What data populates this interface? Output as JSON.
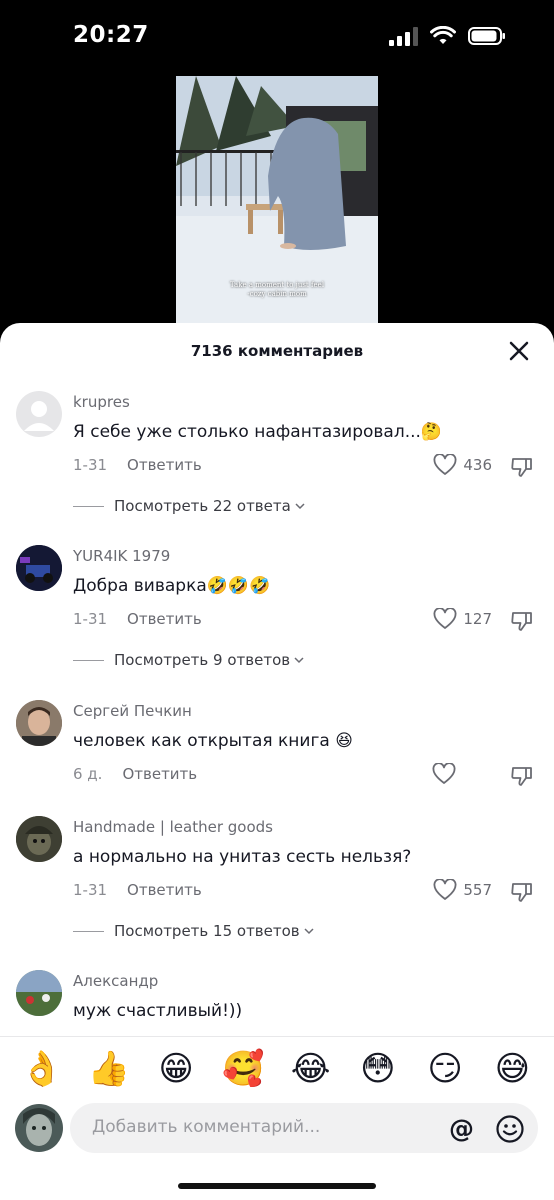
{
  "status_bar": {
    "time": "20:27"
  },
  "video": {
    "caption_line1": "Take a moment to just feel",
    "caption_line2": "-cozy cabin mom"
  },
  "sheet": {
    "title": "7136 комментариев"
  },
  "comments": [
    {
      "username": "krupres",
      "text": "Я себе уже столько нафантазировал...🤔",
      "date": "1-31",
      "reply_label": "Ответить",
      "likes": "436",
      "view_replies": "Посмотреть 22 ответа"
    },
    {
      "username": "YUR4IK 1979",
      "text": "Добра виварка🤣🤣🤣",
      "date": "1-31",
      "reply_label": "Ответить",
      "likes": "127",
      "view_replies": "Посмотреть 9 ответов"
    },
    {
      "username": "Сергей Печкин",
      "text": "человек как открытая книга 😆",
      "date": "6 д.",
      "reply_label": "Ответить",
      "likes": ""
    },
    {
      "username": "Handmade | leather goods",
      "text": "а нормально на унитаз сесть нельзя?",
      "date": "1-31",
      "reply_label": "Ответить",
      "likes": "557",
      "view_replies": "Посмотреть 15 ответов"
    },
    {
      "username": "Александр",
      "text": "муж счастливый!))"
    }
  ],
  "emoji_bar": [
    "👌",
    "👍",
    "😁",
    "🥰",
    "😂",
    "😳",
    "😏",
    "😅"
  ],
  "input": {
    "placeholder": "Добавить комментарий...",
    "at_label": "@"
  },
  "icons": {
    "close": "close-icon",
    "like": "heart-outline-icon",
    "dislike": "thumbs-down-icon",
    "chevron": "chevron-down-icon",
    "smile": "smile-icon",
    "wifi": "wifi-icon",
    "battery": "battery-icon",
    "signal": "signal-icon"
  }
}
